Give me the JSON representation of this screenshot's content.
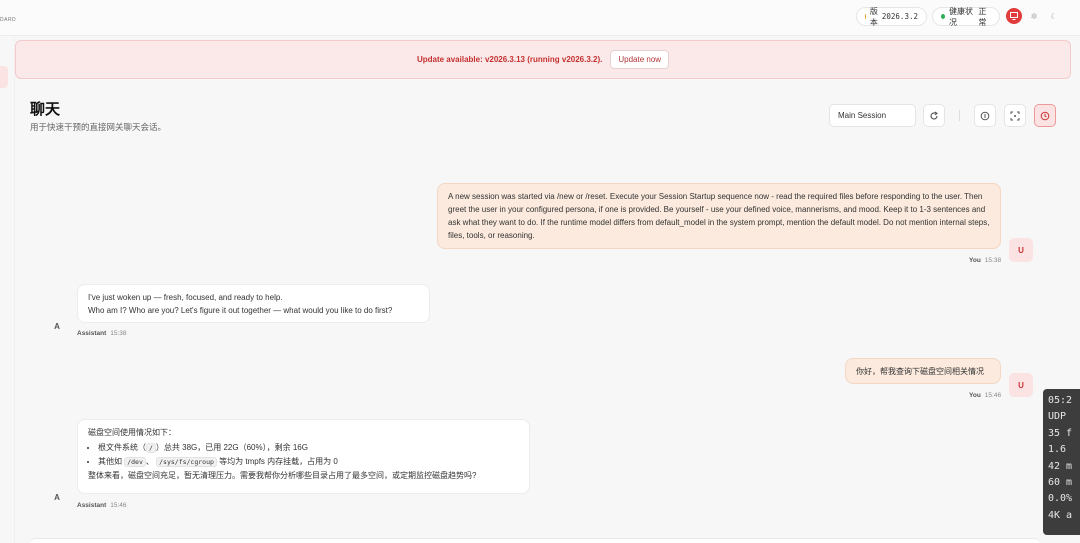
{
  "topbar": {
    "brand": "DARD",
    "version_label": "版本",
    "version_value": "2026.3.2",
    "health_label": "健康状况",
    "health_value": "正常"
  },
  "banner": {
    "text": "Update available: v2026.3.13 (running v2026.3.2).",
    "button": "Update now"
  },
  "header": {
    "title": "聊天",
    "subtitle": "用于快速干预的直接网关聊天会话。",
    "session": "Main Session"
  },
  "messages": [
    {
      "role": "user",
      "text": "A new session was started via /new or /reset. Execute your Session Startup sequence now - read the required files before responding to the user. Then greet the user in your configured persona, if one is provided. Be yourself - use your defined voice, mannerisms, and mood. Keep it to 1-3 sentences and ask what they want to do. If the runtime model differs from default_model in the system prompt, mention the default model. Do not mention internal steps, files, tools, or reasoning.",
      "sender": "You",
      "time": "15:38",
      "avatar": "U"
    },
    {
      "role": "assistant",
      "line1": "I've just woken up — fresh, focused, and ready to help.",
      "line2": "Who am I? Who are you? Let's figure it out together — what would you like to do first?",
      "sender": "Assistant",
      "time": "15:38",
      "avatar": "A"
    },
    {
      "role": "user",
      "text": "你好，帮我查询下磁盘空间相关情况",
      "sender": "You",
      "time": "15:46",
      "avatar": "U"
    },
    {
      "role": "assistant",
      "intro": "磁盘空间使用情况如下：",
      "b1_a": "根文件系统（",
      "b1_code": "/",
      "b1_b": "）总共 38G，已用 22G（60%），剩余 16G",
      "b2_a": "其他如",
      "b2_code1": "/dev",
      "b2_sep": "、",
      "b2_code2": "/sys/fs/cgroup",
      "b2_b": "等均为 tmpfs 内存挂载，占用为 0",
      "outro": "整体来看，磁盘空间充足，暂无清理压力。需要我帮你分析哪些目录占用了最多空间，或定期监控磁盘趋势吗?",
      "sender": "Assistant",
      "time": "15:46",
      "avatar": "A"
    }
  ],
  "overlay": [
    "05:2",
    "UDP",
    "35 f",
    "1.6",
    "42 m",
    "60 m",
    "0.0%",
    "4K a"
  ],
  "colors": {
    "accent": "#e23b3b",
    "banner_bg": "#fbe9e9",
    "user_bubble": "#fbeadd"
  }
}
